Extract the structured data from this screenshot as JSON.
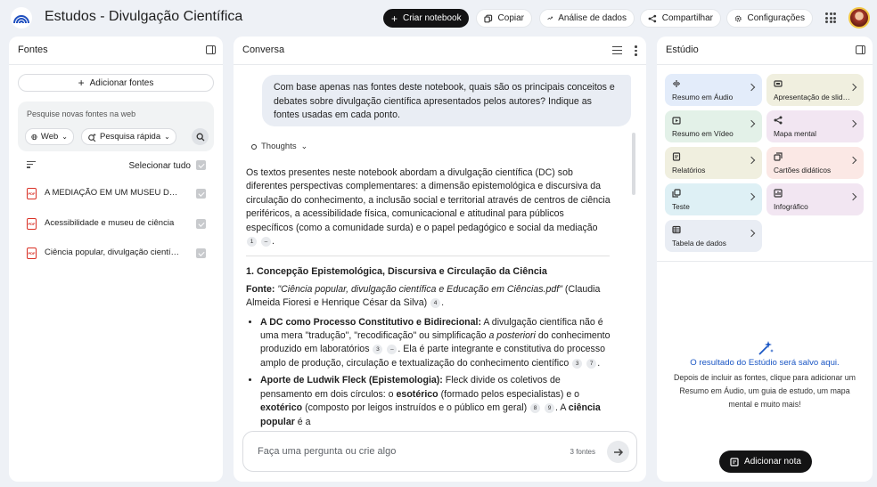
{
  "app": {
    "title": "Estudos - Divulgação Científica"
  },
  "toolbar": {
    "create_notebook": "Criar notebook",
    "copy": "Copiar",
    "analytics": "Análise de dados",
    "share": "Compartilhar",
    "settings": "Configurações"
  },
  "sources": {
    "title": "Fontes",
    "add_label": "Adicionar fontes",
    "search_placeholder": "Pesquise novas fontes na web",
    "web_chip": "Web",
    "mode_chip": "Pesquisa rápida",
    "select_all": "Selecionar tudo",
    "items": [
      {
        "label": "A MEDIAÇÃO EM UM MUSEU DE CIÊNCIAS",
        "checked": true
      },
      {
        "label": "Acessibilidade e museu de ciência",
        "checked": true
      },
      {
        "label": "Ciência popular, divulgação científica",
        "checked": true
      }
    ]
  },
  "chat": {
    "title": "Conversa",
    "user_message": "Com base apenas nas fontes deste notebook, quais são os principais conceitos e debates sobre divulgação científica apresentados pelos autores? Indique as fontes usadas em cada ponto.",
    "thoughts_label": "Thoughts",
    "intro": "Os textos presentes neste notebook abordam a divulgação científica (DC) sob diferentes perspectivas complementares: a dimensão epistemológica e discursiva da circulação do conhecimento, a inclusão social e territorial através de centros de ciência periféricos, a acessibilidade física, comunicacional e atitudinal para públicos específicos (como a comunidade surda) e o papel pedagógico e social da mediação",
    "intro_cites": [
      "1",
      "–"
    ],
    "section_title": "1. Concepção Epistemológica, Discursiva e Circulação da Ciência",
    "source_label": "Fonte:",
    "source_title": "\"Ciência popular, divulgação científica e Educação em Ciências.pdf\"",
    "source_authors": "(Claudia Almeida Fioresi e Henrique César da Silva)",
    "source_cite": "4",
    "bullet1_bold": "A DC como Processo Constitutivo e Bidirecional:",
    "bullet1_text_a": "A divulgação científica não é uma mera \"tradução\", \"recodificação\" ou simplificação",
    "bullet1_italic": "a posteriori",
    "bullet1_text_b": "do conhecimento produzido em laboratórios",
    "bullet1_cites_a": [
      "3",
      "–"
    ],
    "bullet1_text_c": ". Ela é parte integrante e constitutiva do processo amplo de produção, circulação e textualização do conhecimento científico",
    "bullet1_cites_b": [
      "3",
      "7"
    ],
    "bullet2_bold": "Aporte de Ludwik Fleck (Epistemologia):",
    "bullet2_text_a": "Fleck divide os coletivos de pensamento em dois círculos: o",
    "bullet2_bold_b": "esotérico",
    "bullet2_text_b": "(formado pelos especialistas) e o",
    "bullet2_bold_c": "exotérico",
    "bullet2_text_c": "(composto por leigos instruídos e o público em geral)",
    "bullet2_cites": [
      "8",
      "9"
    ],
    "bullet2_text_d": ". A",
    "bullet2_bold_d": "ciência popular",
    "bullet2_text_e": "é a",
    "composer_placeholder": "Faça uma pergunta ou crie algo",
    "source_count": "3 fontes"
  },
  "studio": {
    "title": "Estúdio",
    "cards": [
      {
        "label": "Resumo em Áudio",
        "bg": "#e3ecfa",
        "icon": "audio-icon"
      },
      {
        "label": "Apresentação de slides",
        "bg": "#f0efdf",
        "icon": "slides-icon"
      },
      {
        "label": "Resumo em Vídeo",
        "bg": "#e3f1e8",
        "icon": "video-icon"
      },
      {
        "label": "Mapa mental",
        "bg": "#f2e6f2",
        "icon": "mindmap-icon"
      },
      {
        "label": "Relatórios",
        "bg": "#f0efdf",
        "icon": "report-icon"
      },
      {
        "label": "Cartões didáticos",
        "bg": "#fbe8e5",
        "icon": "flashcards-icon"
      },
      {
        "label": "Teste",
        "bg": "#def0f5",
        "icon": "quiz-icon"
      },
      {
        "label": "Infográfico",
        "bg": "#f2e6f2",
        "icon": "infographic-icon"
      },
      {
        "label": "Tabela de dados",
        "bg": "#e9edf4",
        "icon": "table-icon"
      }
    ],
    "empty_title": "O resultado do Estúdio será salvo aqui.",
    "empty_desc": "Depois de incluir as fontes, clique para adicionar um Resumo em Áudio, um guia de estudo, um mapa mental e muito mais!",
    "add_note": "Adicionar nota"
  }
}
